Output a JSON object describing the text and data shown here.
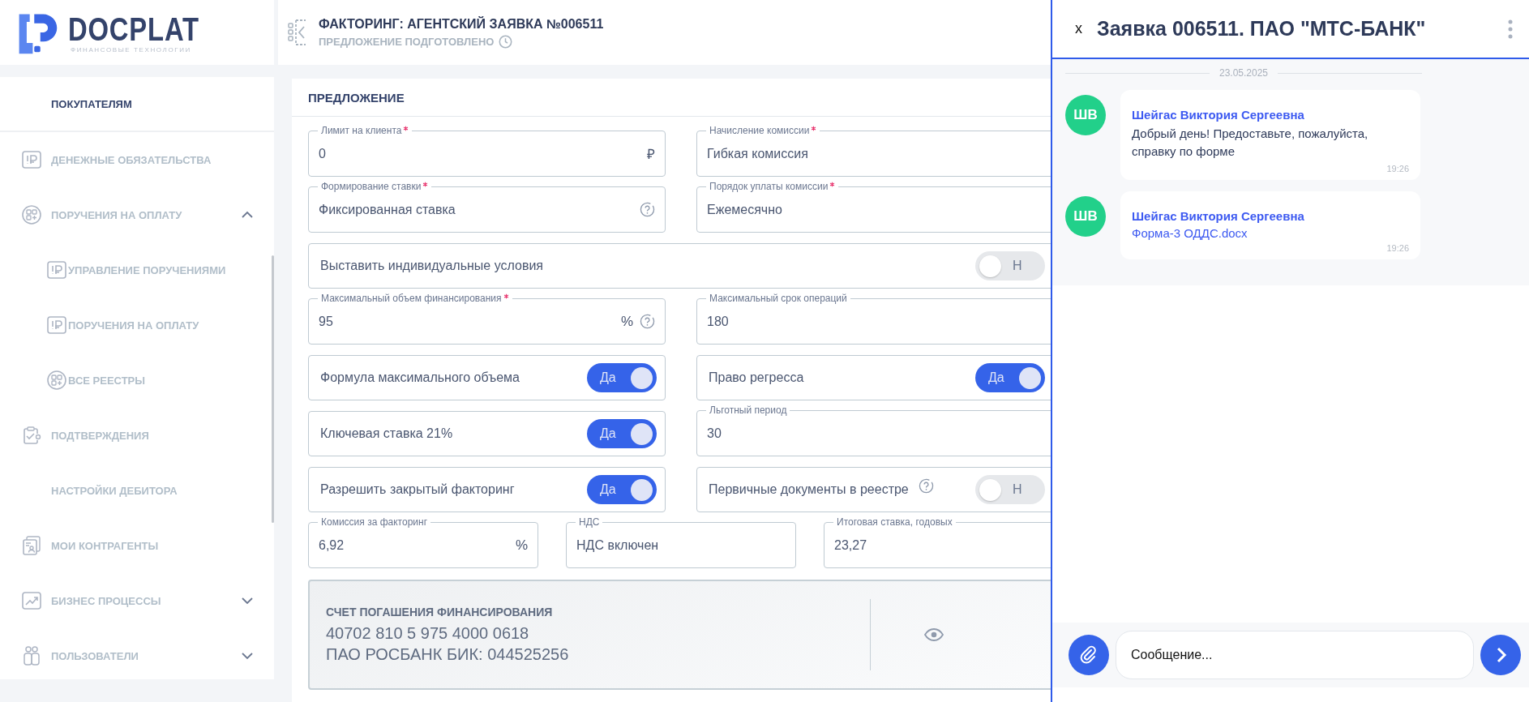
{
  "logo": {
    "name": "DOCPLAT",
    "tagline": "ФИНАНСОВЫЕ ТЕХНОЛОГИИ"
  },
  "sidebar": {
    "items": [
      {
        "label": "ПОКУПАТЕЛЯМ",
        "selected": true
      },
      {
        "label": "ДЕНЕЖНЫЕ ОБЯЗАТЕЛЬСТВА",
        "selected": false
      },
      {
        "label": "ПОРУЧЕНИЯ НА ОПЛАТУ",
        "selected": false,
        "expanded": true,
        "children": [
          {
            "label": "УПРАВЛЕНИЕ ПОРУЧЕНИЯМИ",
            "selected": false
          },
          {
            "label": "ПОРУЧЕНИЯ НА ОПЛАТУ",
            "selected": false
          },
          {
            "label": "ВСЕ РЕЕСТРЫ",
            "selected": false
          }
        ]
      },
      {
        "label": "ПОДТВЕРЖДЕНИЯ",
        "selected": false
      },
      {
        "label": "НАСТРОЙКИ ДЕБИТОРА",
        "selected": false
      },
      {
        "label": "МОИ КОНТРАГЕНТЫ",
        "selected": false
      },
      {
        "label": "БИЗНЕС ПРОЦЕССЫ",
        "selected": false,
        "expanded": false
      },
      {
        "label": "ПОЛЬЗОВАТЕЛИ",
        "selected": false,
        "expanded": false
      }
    ]
  },
  "header": {
    "title": "ФАКТОРИНГ: АГЕНТСКИЙ ЗАЯВКА №006511",
    "status": "ПРЕДЛОЖЕНИЕ ПОДГОТОВЛЕНО"
  },
  "form": {
    "title": "ПРЕДЛОЖЕНИЕ",
    "rows": [
      {
        "fields": [
          {
            "kind": "input",
            "label": "Лимит на клиента",
            "required": true,
            "value": "0",
            "unit": "₽"
          },
          {
            "kind": "input",
            "label": "Начисление комиссии",
            "required": true,
            "value": "Гибкая комиссия"
          }
        ]
      },
      {
        "fields": [
          {
            "kind": "input",
            "label": "Формирование ставки",
            "required": true,
            "value": "Фиксированная ставка",
            "help": true
          },
          {
            "kind": "input",
            "label": "Порядок уплаты комиссии",
            "required": true,
            "value": "Ежемесячно"
          }
        ]
      },
      {
        "fields": [
          {
            "kind": "toggle",
            "label": "Выставить индивидуальные условия",
            "on": false,
            "state": "Н"
          }
        ]
      },
      {
        "fields": [
          {
            "kind": "input",
            "label": "Максимальный объем финансирования",
            "required": true,
            "value": "95",
            "unit": "%",
            "help": true
          },
          {
            "kind": "input",
            "label": "Максимальный срок операций",
            "required": false,
            "value": "180"
          }
        ]
      },
      {
        "fields": [
          {
            "kind": "toggle",
            "label": "Формула максимального объема",
            "on": true,
            "state": "Да"
          },
          {
            "kind": "toggle",
            "label": "Право регресса",
            "on": true,
            "state": "Да"
          }
        ]
      },
      {
        "fields": [
          {
            "kind": "toggle",
            "label": "Ключевая ставка 21%",
            "on": true,
            "state": "Да"
          },
          {
            "kind": "input",
            "label": "Льготный период",
            "required": false,
            "value": "30"
          }
        ]
      },
      {
        "fields": [
          {
            "kind": "toggle",
            "label": "Разрешить закрытый факторинг",
            "on": true,
            "state": "Да"
          },
          {
            "kind": "toggle",
            "label": "Первичные документы в реестре",
            "on": false,
            "state": "Н",
            "help": true
          }
        ]
      },
      {
        "fields": [
          {
            "kind": "input",
            "label": "Комиссия за факторинг",
            "required": false,
            "value": "6,92",
            "unit": "%"
          },
          {
            "kind": "input",
            "label": "НДС",
            "required": false,
            "value": "НДС включен"
          },
          {
            "kind": "input",
            "label": "Итоговая ставка, годовых",
            "required": false,
            "value": "23,27"
          }
        ]
      }
    ],
    "account": {
      "title": "СЧЕТ ПОГАШЕНИЯ ФИНАНСИРОВАНИЯ",
      "lines": [
        "40702 810 5 975 4000 0618",
        "ПАО РОСБАНК БИК: 044525256"
      ]
    }
  },
  "chat": {
    "close": "x",
    "title": "Заявка 006511. ПАО \"МТС-БАНК\"",
    "date": "23.05.2025",
    "messages": [
      {
        "kind": "text",
        "initials": "ШВ",
        "author": "Шейгас Виктория Сергеевна",
        "text": "Добрый день! Предоставьте, пожалуйста, справку по форме",
        "time": "19:26"
      },
      {
        "kind": "file",
        "initials": "ШВ",
        "author": "Шейгас Виктория Сергеевна",
        "text": "Форма-3 ОДДС.docx",
        "time": "19:26"
      }
    ],
    "input": {
      "placeholder": "Сообщение..."
    }
  }
}
